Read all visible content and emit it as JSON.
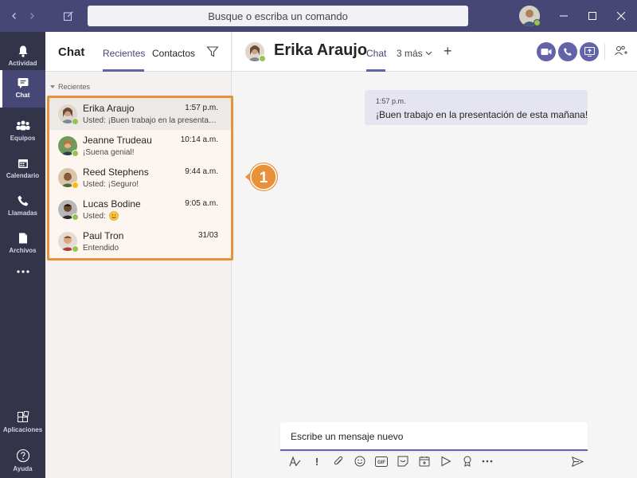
{
  "titlebar": {
    "search_placeholder": "Busque o escriba un comando",
    "back_icon": "chevron-left-icon",
    "forward_icon": "chevron-right-icon",
    "compose_icon": "compose-icon"
  },
  "appbar": {
    "items": [
      {
        "label": "Actividad",
        "icon": "bell-icon"
      },
      {
        "label": "Chat",
        "icon": "chat-icon",
        "active": true
      },
      {
        "label": "Equipos",
        "icon": "teams-icon"
      },
      {
        "label": "Calendario",
        "icon": "calendar-icon"
      },
      {
        "label": "Llamadas",
        "icon": "phone-icon"
      },
      {
        "label": "Archivos",
        "icon": "file-icon"
      },
      {
        "label": "...",
        "icon": "more-icon"
      }
    ],
    "bottom": [
      {
        "label": "Aplicaciones",
        "icon": "apps-icon"
      },
      {
        "label": "Ayuda",
        "icon": "help-icon"
      }
    ]
  },
  "list": {
    "title": "Chat",
    "tabs": [
      "Recientes",
      "Contactos"
    ],
    "section": "Recientes",
    "chats": [
      {
        "name": "Erika Araujo",
        "time": "1:57 p.m.",
        "preview": "Usted: ¡Buen trabajo en la presentación de esta mañana!",
        "status": "green",
        "selected": true
      },
      {
        "name": "Jeanne Trudeau",
        "time": "10:14 a.m.",
        "preview": "¡Suena genial!",
        "status": "green"
      },
      {
        "name": "Reed Stephens",
        "time": "9:44 a.m.",
        "preview": "Usted: ¡Seguro!",
        "status": "yellow"
      },
      {
        "name": "Lucas Bodine",
        "time": "9:05 a.m.",
        "preview": "Usted: ",
        "status": "green",
        "emoji": true
      },
      {
        "name": "Paul Tron",
        "time": "31/03",
        "preview": "Entendido",
        "status": "green"
      }
    ],
    "callout_number": "1"
  },
  "chat": {
    "name": "Erika Araujo",
    "tab": "Chat",
    "more": "3 más",
    "message": {
      "time": "1:57 p.m.",
      "text": "¡Buen trabajo en la presentación de esta mañana!"
    },
    "composer_placeholder": "Escribe un mensaje nuevo"
  },
  "colors": {
    "accent": "#6264a7",
    "titlebar": "#464775",
    "appbar": "#33344a",
    "highlight": "#e8913a"
  }
}
